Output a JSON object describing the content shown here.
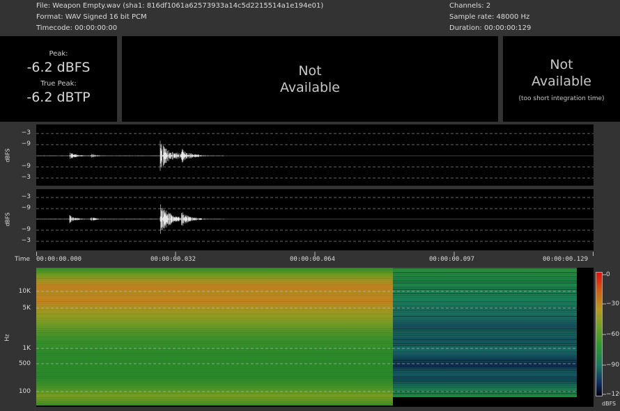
{
  "info": {
    "file": "File: Weapon Empty.wav (sha1: 816df1061a62573933a14c5d2215514a1e194e01)",
    "format": "Format: WAV Signed 16 bit PCM",
    "timecode": "Timecode:  00:00:00:00",
    "channels": "Channels: 2",
    "sample_rate": "Sample rate: 48000 Hz",
    "duration": "Duration:  00:00:00:129"
  },
  "meters": {
    "peak_label": "Peak:",
    "peak_value": "-6.2 dBFS",
    "true_peak_label": "True Peak:",
    "true_peak_value": "-6.2 dBTP",
    "center_na_line1": "Not",
    "center_na_line2": "Available",
    "right_na_line1": "Not",
    "right_na_line2": "Available",
    "right_na_note": "(too short integration time)"
  },
  "waveform": {
    "axis_label": "dBFS",
    "ticks": [
      "−3",
      "−9",
      "−9",
      "−3"
    ],
    "time_label": "Time",
    "time_ticks": [
      "00:00:00.000",
      "00:00:00.032",
      "00:00:00.064",
      "00:00:00.097",
      "00:00:00.129"
    ]
  },
  "spectrogram": {
    "axis_label": "Hz",
    "freq_ticks": [
      "10K",
      "5K",
      "1K",
      "500",
      "100"
    ],
    "colorbar_ticks": [
      "0",
      "−30",
      "−60",
      "−90",
      "−120"
    ],
    "colorbar_unit": "dBFS"
  }
}
